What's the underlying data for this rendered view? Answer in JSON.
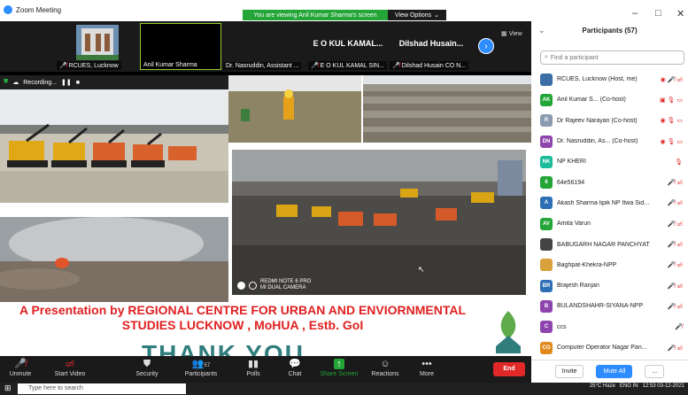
{
  "window": {
    "title": "Zoom Meeting",
    "banner": "You are viewing Anil Kumar Sharma's screen",
    "view_options": "View Options",
    "controls": [
      "–",
      "□",
      "✕"
    ]
  },
  "strip": {
    "tiles": [
      {
        "name": "RCUES, Lucknow",
        "muted": true,
        "big": ""
      },
      {
        "name": "Anil Kumar Sharma",
        "muted": false,
        "big": ""
      },
      {
        "name": "Dr. Nasruddin, Assistant ...",
        "muted": false,
        "big": ""
      },
      {
        "name": "E O KUL KAMAL SIN...",
        "muted": true,
        "big": "E O KUL KAMAL..."
      },
      {
        "name": "Dilshad Husain CO N...",
        "muted": true,
        "big": "Dilshad  Husain..."
      }
    ],
    "view_label": "View"
  },
  "recording": {
    "label": "Recording..."
  },
  "slide": {
    "title_line1": "A Presentation by REGIONAL CENTRE FOR URBAN AND ENVIORNMENTAL",
    "title_line2": "STUDIES LUCKNOW , MoHUA , Estb. GoI",
    "thank": "THANK YOU",
    "camera_line1": "REDMI NOTE 6 PRO",
    "camera_line2": "MI DUAL CAMERA"
  },
  "toolbar": {
    "unmute": "Unmute",
    "start_video": "Start Video",
    "security": "Security",
    "participants": "Participants",
    "participants_count": "57",
    "polls": "Polls",
    "chat": "Chat",
    "share_screen": "Share Screen",
    "reactions": "Reactions",
    "more": "More",
    "end": "End"
  },
  "panel": {
    "header": "Participants (57)",
    "search_placeholder": "Find a participant",
    "participants": [
      {
        "initials": "",
        "color": "#3a6ea5",
        "name": "RCUES, Lucknow (Host, me)",
        "icons": "◉ 🎤̸ ▭̸"
      },
      {
        "initials": "AK",
        "color": "#23a537",
        "name": "Anil Kumar S...  (Co-host)",
        "icons": "▣ 🎙 ▭"
      },
      {
        "initials": "R",
        "color": "#8a9bb0",
        "name": "Dr Rajeev Narayan (Co-host)",
        "icons": "◉ 🎙 ▭"
      },
      {
        "initials": "DN",
        "color": "#8e44ad",
        "name": "Dr. Nasruddin, As... (Co-host)",
        "icons": "◉ 🎙 ▭"
      },
      {
        "initials": "NK",
        "color": "#1abc9c",
        "name": "NP KHERI",
        "icons": "🎙"
      },
      {
        "initials": "6",
        "color": "#23a537",
        "name": "64e56194",
        "icons": "🎤̸ ▭̸"
      },
      {
        "initials": "A",
        "color": "#2d6fb5",
        "name": "Akash Sharma lipik NP Itwa Sid...",
        "icons": "🎤̸ ▭̸"
      },
      {
        "initials": "AV",
        "color": "#23a537",
        "name": "Amita Varun",
        "icons": "🎤̸ ▭̸"
      },
      {
        "initials": "",
        "color": "#444",
        "name": "BABUGARH NAGAR PANCHYAT",
        "icons": "🎤̸ ▭̸"
      },
      {
        "initials": "",
        "color": "#d9a13b",
        "name": "Baghpat-Khekra-NPP",
        "icons": "🎤̸ ▭̸"
      },
      {
        "initials": "BR",
        "color": "#2d6fb5",
        "name": "Brajesh Ranjan",
        "icons": "🎤̸ ▭̸"
      },
      {
        "initials": "B",
        "color": "#8e44ad",
        "name": "BULANDSHAHR-SIYANA-NPP",
        "icons": "🎤̸ ▭̸"
      },
      {
        "initials": "C",
        "color": "#8e44ad",
        "name": "ccs",
        "icons": "🎤̸"
      },
      {
        "initials": "CO",
        "color": "#e08a1e",
        "name": "Computer Operator Nagar Pan...",
        "icons": "🎤̸ ▭̸"
      }
    ],
    "invite": "Invite",
    "mute_all": "Mute All",
    "more": "..."
  },
  "taskbar": {
    "search_placeholder": "Type here to search",
    "weather": "25°C  Haze",
    "lang": "ENG",
    "lang_sub": "IN",
    "time": "12:53",
    "date": "03-12-2021"
  }
}
